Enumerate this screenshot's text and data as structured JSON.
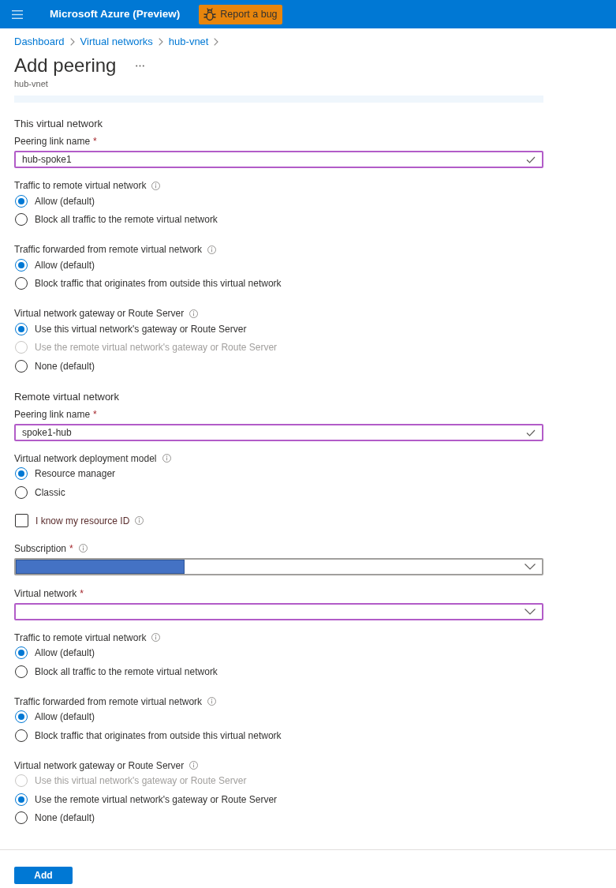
{
  "top_bar": {
    "title": "Microsoft Azure (Preview)",
    "report_button": "Report a bug"
  },
  "breadcrumb": [
    "Dashboard",
    "Virtual networks",
    "hub-vnet"
  ],
  "header": {
    "title": "Add peering",
    "subtitle": "hub-vnet"
  },
  "form": [
    {
      "kind": "heading",
      "text": "This virtual network"
    },
    {
      "kind": "text_field",
      "label": "Peering link name",
      "required_mark": "*",
      "value": "hub-spoke1",
      "highlighted": true,
      "valid": true
    },
    {
      "kind": "radio_group",
      "label": "Traffic to remote virtual network",
      "info": true,
      "options": [
        {
          "label": "Allow (default)",
          "selected": true,
          "disabled": false
        },
        {
          "label": "Block all traffic to the remote virtual network",
          "selected": false,
          "disabled": false
        }
      ]
    },
    {
      "kind": "radio_group",
      "label": "Traffic forwarded from remote virtual network",
      "info": true,
      "options": [
        {
          "label": "Allow (default)",
          "selected": true,
          "disabled": false
        },
        {
          "label": "Block traffic that originates from outside this virtual network",
          "selected": false,
          "disabled": false
        }
      ]
    },
    {
      "kind": "radio_group",
      "label": "Virtual network gateway or Route Server",
      "info": true,
      "options": [
        {
          "label": "Use this virtual network's gateway or Route Server",
          "selected": true,
          "disabled": false
        },
        {
          "label": "Use the remote virtual network's gateway or Route Server",
          "selected": false,
          "disabled": true
        },
        {
          "label": "None (default)",
          "selected": false,
          "disabled": false
        }
      ]
    },
    {
      "kind": "heading",
      "text": "Remote virtual network"
    },
    {
      "kind": "text_field",
      "label": "Peering link name",
      "required_mark": "*",
      "value": "spoke1-hub",
      "highlighted": true,
      "valid": true
    },
    {
      "kind": "radio_group",
      "label": "Virtual network deployment model",
      "info": true,
      "options": [
        {
          "label": "Resource manager",
          "selected": true,
          "disabled": false
        },
        {
          "label": "Classic",
          "selected": false,
          "disabled": false
        }
      ]
    },
    {
      "kind": "checkbox",
      "label": "I know my resource ID",
      "info": true,
      "checked": false
    },
    {
      "kind": "dropdown",
      "label": "Subscription",
      "required_mark": "*",
      "info": true,
      "highlighted": false,
      "redacted": true
    },
    {
      "kind": "dropdown",
      "label": "Virtual network",
      "required_mark": "*",
      "highlighted": true
    },
    {
      "kind": "radio_group",
      "label": "Traffic to remote virtual network",
      "info": true,
      "options": [
        {
          "label": "Allow (default)",
          "selected": true,
          "disabled": false
        },
        {
          "label": "Block all traffic to the remote virtual network",
          "selected": false,
          "disabled": false
        }
      ]
    },
    {
      "kind": "radio_group",
      "label": "Traffic forwarded from remote virtual network",
      "info": true,
      "options": [
        {
          "label": "Allow (default)",
          "selected": true,
          "disabled": false
        },
        {
          "label": "Block traffic that originates from outside this virtual network",
          "selected": false,
          "disabled": false
        }
      ]
    },
    {
      "kind": "radio_group",
      "label": "Virtual network gateway or Route Server",
      "info": true,
      "options": [
        {
          "label": "Use this virtual network's gateway or Route Server",
          "selected": false,
          "disabled": true
        },
        {
          "label": "Use the remote virtual network's gateway or Route Server",
          "selected": true,
          "disabled": false
        },
        {
          "label": "None (default)",
          "selected": false,
          "disabled": false
        }
      ]
    }
  ],
  "footer": {
    "button": "Add"
  }
}
